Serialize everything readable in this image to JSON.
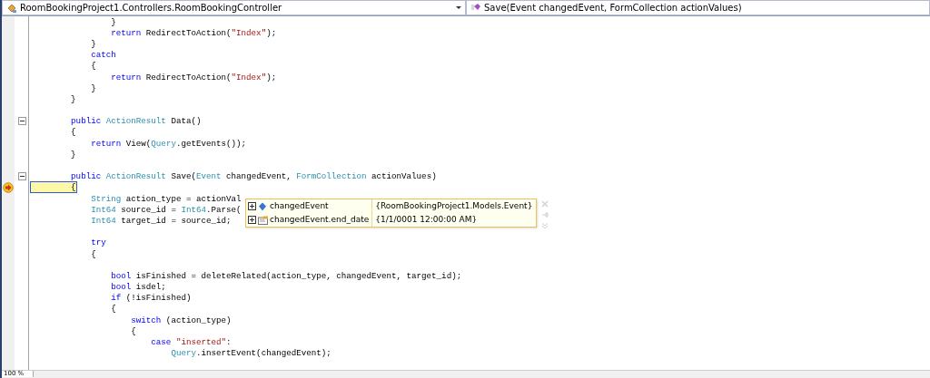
{
  "navigation_bar": {
    "class_dropdown": "RoomBookingProject1.Controllers.RoomBookingController",
    "member_dropdown": "Save(Event changedEvent, FormCollection actionValues)"
  },
  "editor": {
    "lines": [
      {
        "kind": "code",
        "tokens": [
          {
            "t": "                }",
            "kind": "plain"
          }
        ]
      },
      {
        "kind": "code",
        "tokens": [
          {
            "t": "                return",
            "kind": "kw"
          },
          {
            "t": " RedirectToAction(",
            "kind": "plain"
          },
          {
            "t": "\"Index\"",
            "kind": "str"
          },
          {
            "t": ");",
            "kind": "plain"
          }
        ]
      },
      {
        "kind": "code",
        "tokens": [
          {
            "t": "            }",
            "kind": "plain"
          }
        ]
      },
      {
        "kind": "code",
        "tokens": [
          {
            "t": "            catch",
            "kind": "kw"
          }
        ]
      },
      {
        "kind": "code",
        "tokens": [
          {
            "t": "            {",
            "kind": "plain"
          }
        ]
      },
      {
        "kind": "code",
        "tokens": [
          {
            "t": "                return",
            "kind": "kw"
          },
          {
            "t": " RedirectToAction(",
            "kind": "plain"
          },
          {
            "t": "\"Index\"",
            "kind": "str"
          },
          {
            "t": ");",
            "kind": "plain"
          }
        ]
      },
      {
        "kind": "code",
        "tokens": [
          {
            "t": "            }",
            "kind": "plain"
          }
        ]
      },
      {
        "kind": "code",
        "tokens": [
          {
            "t": "        }",
            "kind": "plain"
          }
        ]
      },
      {
        "kind": "blank"
      },
      {
        "kind": "code",
        "fold": true,
        "tokens": [
          {
            "t": "        public",
            "kind": "kw"
          },
          {
            "t": " ActionResult",
            "kind": "type"
          },
          {
            "t": " Data()",
            "kind": "plain"
          }
        ]
      },
      {
        "kind": "code",
        "tokens": [
          {
            "t": "        {",
            "kind": "plain"
          }
        ]
      },
      {
        "kind": "code",
        "tokens": [
          {
            "t": "            return",
            "kind": "kw"
          },
          {
            "t": " View(",
            "kind": "plain"
          },
          {
            "t": "Query",
            "kind": "type"
          },
          {
            "t": ".getEvents());",
            "kind": "plain"
          }
        ]
      },
      {
        "kind": "code",
        "tokens": [
          {
            "t": "        }",
            "kind": "plain"
          }
        ]
      },
      {
        "kind": "blank"
      },
      {
        "kind": "code",
        "fold": true,
        "tokens": [
          {
            "t": "        public",
            "kind": "kw"
          },
          {
            "t": " ActionResult",
            "kind": "type"
          },
          {
            "t": " Save(",
            "kind": "plain"
          },
          {
            "t": "Event",
            "kind": "type"
          },
          {
            "t": " changedEvent, ",
            "kind": "plain"
          },
          {
            "t": "FormCollection",
            "kind": "type"
          },
          {
            "t": " actionValues)",
            "kind": "plain"
          }
        ]
      },
      {
        "kind": "code",
        "current": true,
        "tokens": [
          {
            "t": "        {",
            "kind": "plain"
          }
        ]
      },
      {
        "kind": "code",
        "tokens": [
          {
            "t": "            String",
            "kind": "type"
          },
          {
            "t": " action_type = actionVal",
            "kind": "plain"
          }
        ]
      },
      {
        "kind": "code",
        "tokens": [
          {
            "t": "            Int64",
            "kind": "type"
          },
          {
            "t": " source_id = ",
            "kind": "plain"
          },
          {
            "t": "Int64",
            "kind": "type"
          },
          {
            "t": ".Parse(",
            "kind": "plain"
          }
        ]
      },
      {
        "kind": "code",
        "tokens": [
          {
            "t": "            Int64",
            "kind": "type"
          },
          {
            "t": " target_id = source_id;",
            "kind": "plain"
          }
        ]
      },
      {
        "kind": "blank"
      },
      {
        "kind": "code",
        "tokens": [
          {
            "t": "            try",
            "kind": "kw"
          }
        ]
      },
      {
        "kind": "code",
        "tokens": [
          {
            "t": "            {",
            "kind": "plain"
          }
        ]
      },
      {
        "kind": "blank"
      },
      {
        "kind": "code",
        "tokens": [
          {
            "t": "                bool",
            "kind": "kw"
          },
          {
            "t": " isFinished = deleteRelated(action_type, changedEvent, target_id);",
            "kind": "plain"
          }
        ]
      },
      {
        "kind": "code",
        "tokens": [
          {
            "t": "                bool",
            "kind": "kw"
          },
          {
            "t": " isdel;",
            "kind": "plain"
          }
        ]
      },
      {
        "kind": "code",
        "tokens": [
          {
            "t": "                if",
            "kind": "kw"
          },
          {
            "t": " (!isFinished)",
            "kind": "plain"
          }
        ]
      },
      {
        "kind": "code",
        "tokens": [
          {
            "t": "                {",
            "kind": "plain"
          }
        ]
      },
      {
        "kind": "code",
        "tokens": [
          {
            "t": "                    switch",
            "kind": "kw"
          },
          {
            "t": " (action_type)",
            "kind": "plain"
          }
        ]
      },
      {
        "kind": "code",
        "tokens": [
          {
            "t": "                    {",
            "kind": "plain"
          }
        ]
      },
      {
        "kind": "code",
        "tokens": [
          {
            "t": "                        case",
            "kind": "kw"
          },
          {
            "t": " \"inserted\"",
            "kind": "str"
          },
          {
            "t": ":",
            "kind": "plain"
          }
        ]
      },
      {
        "kind": "code",
        "tokens": [
          {
            "t": "                            Query",
            "kind": "type"
          },
          {
            "t": ".insertEvent(changedEvent);",
            "kind": "plain"
          }
        ]
      }
    ]
  },
  "datatip": {
    "rows": [
      {
        "kind": "object",
        "name": "changedEvent",
        "value": "{RoomBookingProject1.Models.Event}"
      },
      {
        "kind": "property",
        "name": "changedEvent.end_date",
        "value": "{1/1/0001 12:00:00 AM}"
      }
    ]
  },
  "status_bar": {
    "zoom": "100 %"
  }
}
